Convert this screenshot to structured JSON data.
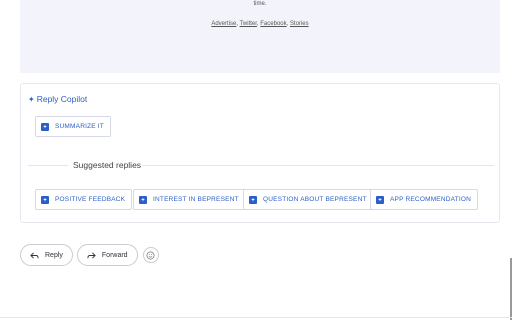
{
  "email_footer": {
    "time_text": "time.",
    "links": [
      "Advertise",
      "Twitter",
      "Facebook",
      "Stories"
    ]
  },
  "copilot": {
    "title": "Reply Copilot",
    "summarize_label": "SUMMARIZE IT",
    "suggested_heading": "Suggested replies",
    "suggestions": [
      "POSITIVE FEEDBACK",
      "INTEREST IN BEPRESENT",
      "QUESTION ABOUT BEPRESENT",
      "APP RECOMMENDATION"
    ],
    "accent_color": "#2b5fc7"
  },
  "actions": {
    "reply_label": "Reply",
    "forward_label": "Forward",
    "emoji_icon": "smiley-icon"
  }
}
